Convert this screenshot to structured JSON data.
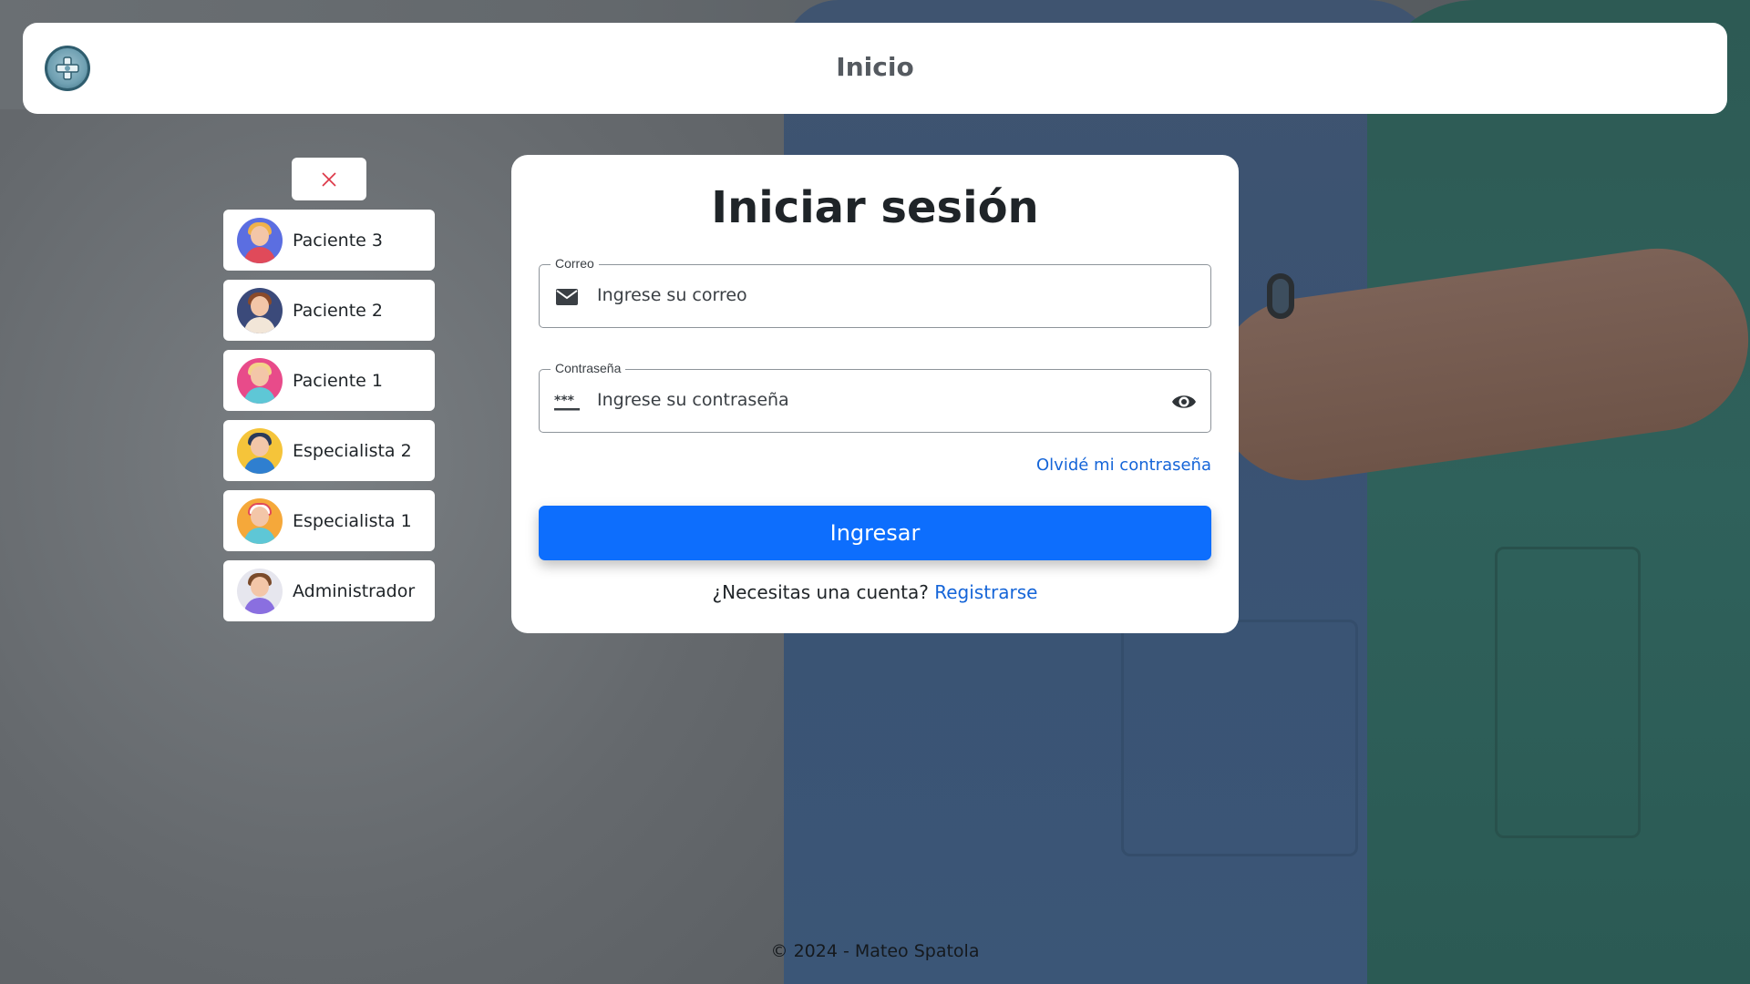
{
  "header": {
    "title": "Inicio",
    "logo_icon": "medical-logo-icon"
  },
  "quick_access": {
    "close_icon": "close-icon",
    "items": [
      {
        "label": "Paciente 3",
        "avatar": "patient-mask-avatar",
        "color": "#5b6ee1"
      },
      {
        "label": "Paciente 2",
        "avatar": "patient-sick-avatar",
        "color": "#3b4a7a"
      },
      {
        "label": "Paciente 1",
        "avatar": "patient-woman-avatar",
        "color": "#e84b8a"
      },
      {
        "label": "Especialista 2",
        "avatar": "doctor-man-avatar",
        "color": "#f5c43a"
      },
      {
        "label": "Especialista 1",
        "avatar": "nurse-avatar",
        "color": "#f5a83a"
      },
      {
        "label": "Administrador",
        "avatar": "admin-coder-avatar",
        "color": "#8a8fe0"
      }
    ]
  },
  "login": {
    "title": "Iniciar sesión",
    "email": {
      "legend": "Correo",
      "placeholder": "Ingrese su correo",
      "icon": "envelope-icon"
    },
    "password": {
      "legend": "Contraseña",
      "placeholder": "Ingrese su contraseña",
      "icon": "password-dots-icon",
      "toggle_icon": "eye-icon"
    },
    "forgot": "Olvidé mi contraseña",
    "submit": "Ingresar",
    "signup_prompt": "¿Necesitas una cuenta?",
    "signup_link": "Registrarse"
  },
  "footer": "© 2024 - Mateo Spatola",
  "colors": {
    "primary": "#0d6efd",
    "link": "#1565d8",
    "surface": "#ffffff"
  }
}
